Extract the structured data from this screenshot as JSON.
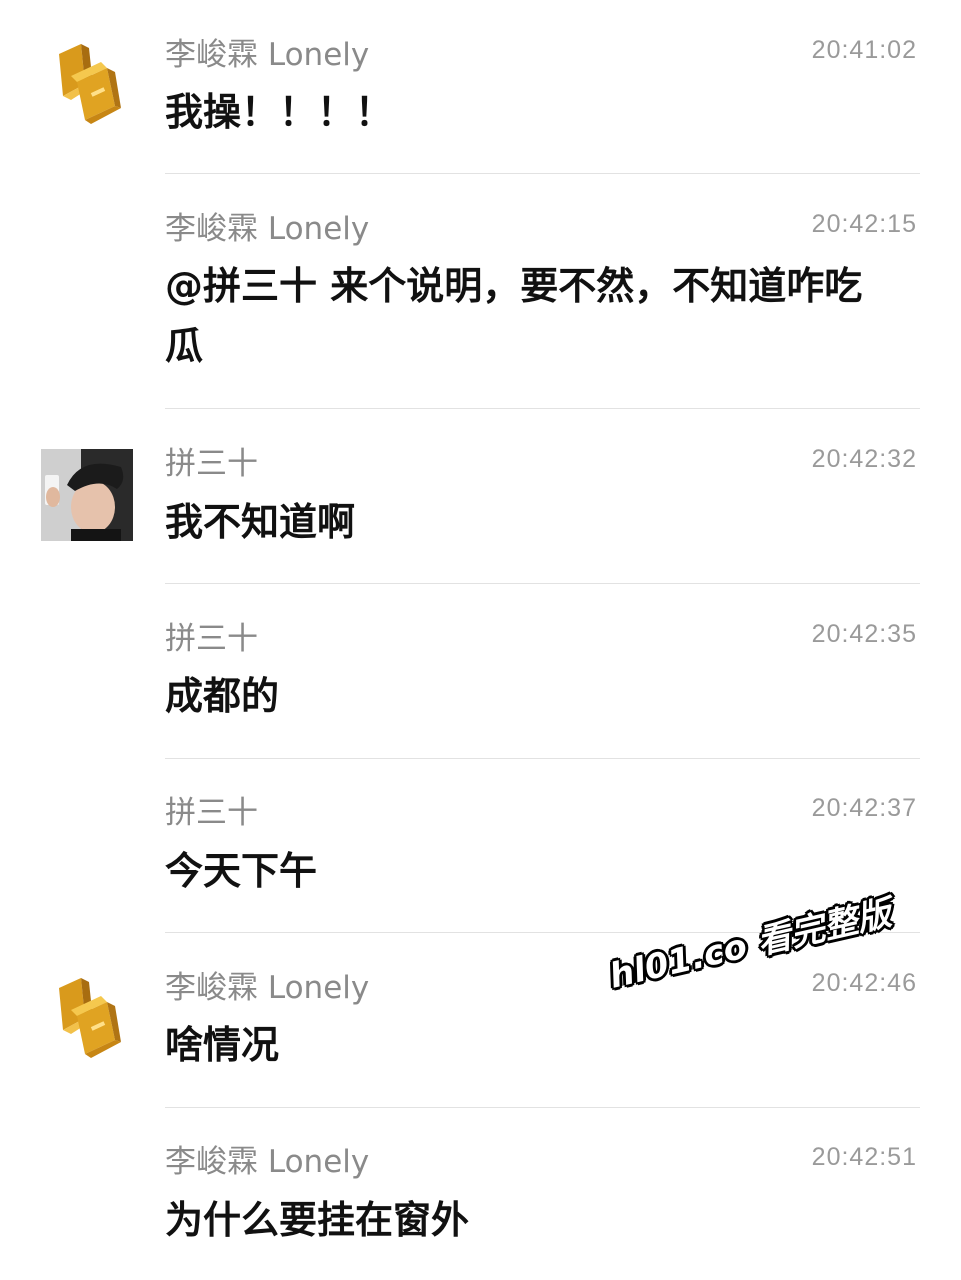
{
  "messages": [
    {
      "sender": "李峻霖 Lonely",
      "time": "20:41:02",
      "text": "我操！！！！",
      "avatar": "gold-bars-icon"
    },
    {
      "sender": "李峻霖 Lonely",
      "time": "20:42:15",
      "text": "@拼三十 来个说明，要不然，不知道咋吃瓜",
      "avatar": null
    },
    {
      "sender": "拼三十",
      "time": "20:42:32",
      "text": "我不知道啊",
      "avatar": "user-photo"
    },
    {
      "sender": "拼三十",
      "time": "20:42:35",
      "text": "成都的",
      "avatar": null
    },
    {
      "sender": "拼三十",
      "time": "20:42:37",
      "text": "今天下午",
      "avatar": null
    },
    {
      "sender": "李峻霖 Lonely",
      "time": "20:42:46",
      "text": "啥情况",
      "avatar": "gold-bars-icon"
    },
    {
      "sender": "李峻霖 Lonely",
      "time": "20:42:51",
      "text": "为什么要挂在窗外",
      "avatar": null
    }
  ],
  "watermark": "hl01.co 看完整版",
  "colors": {
    "sender": "#8a8a8a",
    "time": "#9a9a9a",
    "text": "#111111",
    "divider": "#e2e2e2"
  }
}
